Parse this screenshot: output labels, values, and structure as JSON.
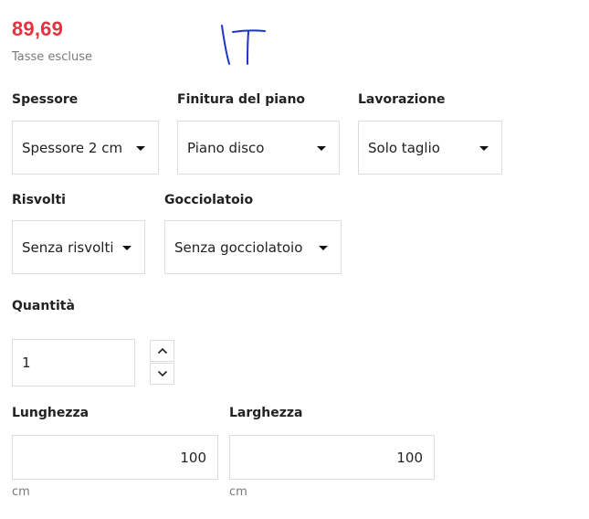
{
  "price": {
    "value": "89,69",
    "tax_note": "Tasse escluse"
  },
  "options": {
    "spessore": {
      "label": "Spessore",
      "selected": "Spessore 2 cm"
    },
    "finitura": {
      "label": "Finitura del piano",
      "selected": "Piano disco"
    },
    "lavorazione": {
      "label": "Lavorazione",
      "selected": "Solo taglio"
    },
    "risvolti": {
      "label": "Risvolti",
      "selected": "Senza risvolti"
    },
    "gocciolatoio": {
      "label": "Gocciolatoio",
      "selected": "Senza gocciolatoio"
    }
  },
  "quantity": {
    "label": "Quantità",
    "value": "1"
  },
  "dimensions": {
    "lunghezza": {
      "label": "Lunghezza",
      "value": "100",
      "unit": "cm"
    },
    "larghezza": {
      "label": "Larghezza",
      "value": "100",
      "unit": "cm"
    }
  },
  "icons": {
    "select_caret": "caret-down-icon",
    "qty_up": "chevron-up-icon",
    "qty_down": "chevron-down-icon"
  },
  "colors": {
    "price": "#e2333f",
    "border": "#dcdcdc",
    "muted": "#7a7a7a"
  }
}
